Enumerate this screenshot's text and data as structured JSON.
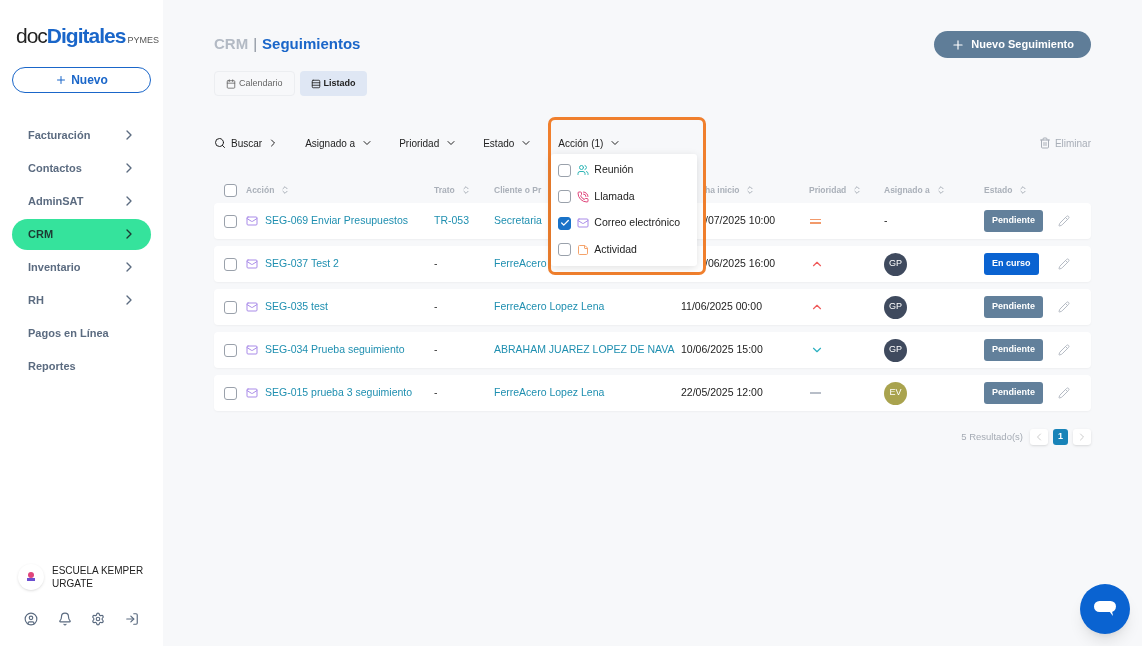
{
  "sidebar": {
    "logo": {
      "prefix": "doc",
      "brand": "Digitales",
      "suffix": "PYMES"
    },
    "new_button": "Nuevo",
    "items": [
      {
        "label": "Facturación",
        "has_children": true,
        "selected": false
      },
      {
        "label": "Contactos",
        "has_children": true,
        "selected": false
      },
      {
        "label": "AdminSAT",
        "has_children": true,
        "selected": false
      },
      {
        "label": "CRM",
        "has_children": true,
        "selected": true
      },
      {
        "label": "Inventario",
        "has_children": true,
        "selected": false
      },
      {
        "label": "RH",
        "has_children": true,
        "selected": false
      },
      {
        "label": "Pagos en Línea",
        "has_children": false,
        "selected": false
      },
      {
        "label": "Reportes",
        "has_children": false,
        "selected": false
      }
    ],
    "organization": "ESCUELA KEMPER URGATE"
  },
  "header": {
    "section": "CRM",
    "separator": "|",
    "title": "Seguimientos",
    "action_button": "Nuevo Seguimiento"
  },
  "view_tabs": [
    {
      "label": "Calendario",
      "kind": "calendar",
      "selected": false
    },
    {
      "label": "Listado",
      "kind": "list",
      "selected": true
    }
  ],
  "filters": {
    "search": "Buscar",
    "dropdowns": [
      "Asignado a",
      "Prioridad",
      "Estado"
    ],
    "action_filter": "Acción (1)",
    "delete": "Eliminar",
    "action_options": [
      {
        "label": "Reunión",
        "kind": "meeting",
        "checked": false
      },
      {
        "label": "Llamada",
        "kind": "call",
        "checked": false
      },
      {
        "label": "Correo electrónico",
        "kind": "email",
        "checked": true
      },
      {
        "label": "Actividad",
        "kind": "activity",
        "checked": false
      }
    ]
  },
  "table": {
    "select_all_checked": false,
    "columns": [
      "Acción",
      "Trato",
      "Cliente o Pr",
      "ha inicio",
      "Prioridad",
      "Asignado a",
      "Estado"
    ],
    "rows": [
      {
        "checked": false,
        "accion": "SEG-069 Enviar Presupuestos",
        "trato": "TR-053",
        "cliente": "Secretaria",
        "fecha": "/07/2025 10:00",
        "partial_date": true,
        "priority": {
          "kind": "medium"
        },
        "assigned": {
          "kind": "none",
          "text": "-"
        },
        "status": {
          "kind": "pending",
          "text": "Pendiente"
        }
      },
      {
        "checked": false,
        "accion": "SEG-037 Test 2",
        "trato": "-",
        "cliente": "FerreAcero",
        "fecha": "/06/2025 16:00",
        "partial_date": true,
        "priority": {
          "kind": "high"
        },
        "assigned": {
          "kind": "avatar",
          "text": "GP",
          "color": "#3f4a5e"
        },
        "status": {
          "kind": "in_progress",
          "text": "En curso"
        }
      },
      {
        "checked": false,
        "accion": "SEG-035 test",
        "trato": "-",
        "cliente": "FerreAcero Lopez Lena",
        "fecha": "11/06/2025 00:00",
        "partial_date": false,
        "priority": {
          "kind": "high"
        },
        "assigned": {
          "kind": "avatar",
          "text": "GP",
          "color": "#3f4a5e"
        },
        "status": {
          "kind": "pending",
          "text": "Pendiente"
        }
      },
      {
        "checked": false,
        "accion": "SEG-034 Prueba seguimiento",
        "trato": "-",
        "cliente": "ABRAHAM JUAREZ LOPEZ DE NAVA",
        "fecha": "10/06/2025 15:00",
        "partial_date": false,
        "priority": {
          "kind": "low"
        },
        "assigned": {
          "kind": "avatar",
          "text": "GP",
          "color": "#3f4a5e"
        },
        "status": {
          "kind": "pending",
          "text": "Pendiente"
        }
      },
      {
        "checked": false,
        "accion": "SEG-015 prueba 3 seguimiento",
        "trato": "-",
        "cliente": "FerreAcero Lopez Lena",
        "fecha": "22/05/2025 12:00",
        "partial_date": false,
        "priority": {
          "kind": "none"
        },
        "assigned": {
          "kind": "avatar",
          "text": "EV",
          "color": "#a9a34e"
        },
        "status": {
          "kind": "pending",
          "text": "Pendiente"
        }
      }
    ]
  },
  "pagination": {
    "results": "5 Resultado(s)",
    "pages": [
      {
        "label": "1",
        "selected": true
      }
    ]
  }
}
